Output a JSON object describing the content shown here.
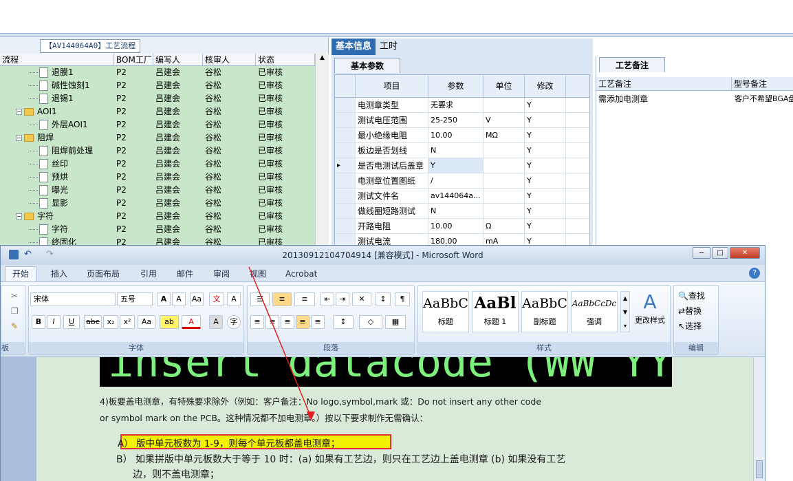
{
  "tree": {
    "title": "【AV144064A0】工艺流程",
    "columns": [
      "流程",
      "BOM工厂",
      "编写人",
      "核审人",
      "状态"
    ],
    "rows": [
      {
        "node": "退膜1",
        "type": "file",
        "indent": 3,
        "factory": "P2",
        "writer": "吕建会",
        "reviewer": "谷松",
        "status": "已审核"
      },
      {
        "node": "碱性蚀刻1",
        "type": "file",
        "indent": 3,
        "factory": "P2",
        "writer": "吕建会",
        "reviewer": "谷松",
        "status": "已审核"
      },
      {
        "node": "退锡1",
        "type": "file",
        "indent": 3,
        "factory": "P2",
        "writer": "吕建会",
        "reviewer": "谷松",
        "status": "已审核"
      },
      {
        "node": "AOI1",
        "type": "folder",
        "indent": 2,
        "factory": "P2",
        "writer": "吕建会",
        "reviewer": "谷松",
        "status": "已审核"
      },
      {
        "node": "外层AOI1",
        "type": "file",
        "indent": 3,
        "factory": "P2",
        "writer": "吕建会",
        "reviewer": "谷松",
        "status": "已审核"
      },
      {
        "node": "阻焊",
        "type": "folder",
        "indent": 2,
        "factory": "P2",
        "writer": "吕建会",
        "reviewer": "谷松",
        "status": "已审核"
      },
      {
        "node": "阻焊前处理",
        "type": "file",
        "indent": 3,
        "factory": "P2",
        "writer": "吕建会",
        "reviewer": "谷松",
        "status": "已审核"
      },
      {
        "node": "丝印",
        "type": "file",
        "indent": 3,
        "factory": "P2",
        "writer": "吕建会",
        "reviewer": "谷松",
        "status": "已审核"
      },
      {
        "node": "预烘",
        "type": "file",
        "indent": 3,
        "factory": "P2",
        "writer": "吕建会",
        "reviewer": "谷松",
        "status": "已审核"
      },
      {
        "node": "曝光",
        "type": "file",
        "indent": 3,
        "factory": "P2",
        "writer": "吕建会",
        "reviewer": "谷松",
        "status": "已审核"
      },
      {
        "node": "显影",
        "type": "file",
        "indent": 3,
        "factory": "P2",
        "writer": "吕建会",
        "reviewer": "谷松",
        "status": "已审核"
      },
      {
        "node": "字符",
        "type": "folder",
        "indent": 2,
        "factory": "P2",
        "writer": "吕建会",
        "reviewer": "谷松",
        "status": "已审核"
      },
      {
        "node": "字符",
        "type": "file",
        "indent": 3,
        "factory": "P2",
        "writer": "吕建会",
        "reviewer": "谷松",
        "status": "已审核"
      },
      {
        "node": "终固化",
        "type": "file",
        "indent": 3,
        "factory": "P2",
        "writer": "吕建会",
        "reviewer": "谷松",
        "status": "已审核"
      }
    ]
  },
  "mid": {
    "tabs": [
      "基本信息",
      "工时"
    ],
    "subtab": "基本参数",
    "columns": [
      "项目",
      "参数",
      "单位",
      "修改"
    ],
    "rows": [
      {
        "item": "电测章类型",
        "param": "无要求",
        "unit": "",
        "mod": "Y"
      },
      {
        "item": "测试电压范围",
        "param": "25-250",
        "unit": "V",
        "mod": "Y"
      },
      {
        "item": "最小绝缘电阻",
        "param": "10.00",
        "unit": "MΩ",
        "mod": "Y"
      },
      {
        "item": "板边是否划线",
        "param": "N",
        "unit": "",
        "mod": "Y"
      },
      {
        "item": "是否电测试后盖章",
        "param": "Y",
        "unit": "",
        "mod": "Y",
        "current": true
      },
      {
        "item": "电测章位置图纸",
        "param": "/",
        "unit": "",
        "mod": "Y"
      },
      {
        "item": "测试文件名",
        "param": "av144064a...",
        "unit": "",
        "mod": "Y"
      },
      {
        "item": "做线圈短路测试",
        "param": "N",
        "unit": "",
        "mod": "Y"
      },
      {
        "item": "开路电阻",
        "param": "10.00",
        "unit": "Ω",
        "mod": "Y"
      },
      {
        "item": "测试电流",
        "param": "180.00",
        "unit": "mA",
        "mod": "Y"
      }
    ]
  },
  "right": {
    "tab": "工艺备注",
    "col1": "工艺备注",
    "col2": "型号备注",
    "note1": "需添加电测章",
    "note2": "客户不希望BGA盘"
  },
  "word": {
    "title": "20130912104704914 [兼容模式] - Microsoft Word",
    "tabs": [
      "开始",
      "插入",
      "页面布局",
      "引用",
      "邮件",
      "审阅",
      "视图",
      "Acrobat"
    ],
    "font_name": "宋体",
    "font_size": "五号",
    "groups": {
      "font": "字体",
      "para": "段落",
      "styles": "样式",
      "edit": "编辑",
      "clip": "板"
    },
    "styles": [
      {
        "sample": "AaBbC",
        "label": "标题"
      },
      {
        "sample": "AaBl",
        "label": "标题 1"
      },
      {
        "sample": "AaBbC",
        "label": "副标题"
      },
      {
        "sample": "AaBbCcDc",
        "label": "强调"
      }
    ],
    "change_style": "更改样式",
    "edit": {
      "find": "查找",
      "replace": "替换",
      "select": "选择"
    },
    "doc": {
      "banner": "insert datacode (WW YY)",
      "line1": "4)板要盖电测章，有特殊要求除外（例如：客户备注：No logo,symbol,mark 或：Do not insert any other code",
      "line2": "or symbol mark on the PCB。这种情况都不加电测章。）按以下要求制作无需确认：",
      "item_a": "A） 版中单元板数为 1-9，则每个单元板都盖电测章；",
      "item_b1": "B） 如果拼版中单元板数大于等于 10 时：(a) 如果有工艺边，则只在工艺边上盖电测章 (b) 如果没有工艺",
      "item_b2": "边，则不盖电测章；"
    }
  },
  "colors": {
    "accent": "#2f6db3",
    "highlight": "#f2f200",
    "annotation": "#e03030",
    "doc_bg": "#d9ead8"
  }
}
